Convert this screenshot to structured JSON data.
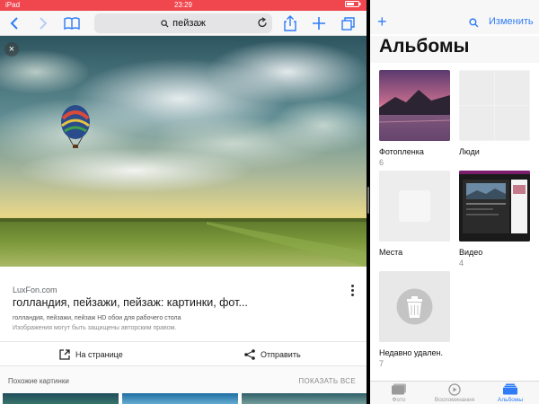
{
  "status_bar": {
    "time": "23:29",
    "left_text": "iPad",
    "battery_text": "■"
  },
  "safari": {
    "search_query": "пейзаж",
    "result": {
      "source": "LuxFon.com",
      "title": "голландия, пейзажи, пейзаж: картинки, фот...",
      "description": "голландия, пейзажи, пейзаж HD обои для рабочего стола",
      "copyright_note": "Изображения могут быть защищены авторским правом."
    },
    "actions": {
      "open_on_page": "На странице",
      "share": "Отправить"
    },
    "similar": {
      "title": "Похожие картинки",
      "show_all": "ПОКАЗАТЬ ВСЕ"
    }
  },
  "photos": {
    "edit_label": "Изменить",
    "title": "Альбомы",
    "albums": [
      {
        "name": "Фотопленка",
        "count": "6"
      },
      {
        "name": "Люди",
        "count": ""
      },
      {
        "name": "Места",
        "count": ""
      },
      {
        "name": "Видео",
        "count": "4"
      },
      {
        "name": "Недавно удален.",
        "count": "7"
      }
    ],
    "tabs": [
      {
        "label": "Фото",
        "active": false
      },
      {
        "label": "Воспоминания",
        "active": false
      },
      {
        "label": "Альбомы",
        "active": true
      }
    ]
  },
  "colors": {
    "accent": "#2f7cf6",
    "status_bar": "#f0474e"
  },
  "icons": [
    "back-icon",
    "forward-icon",
    "bookmarks-icon",
    "search-icon",
    "reload-icon",
    "share-icon",
    "add-tab-icon",
    "tabs-icon",
    "close-icon",
    "open-external-icon",
    "more-vert-icon",
    "plus-icon",
    "trash-icon",
    "photos-icon",
    "memories-icon",
    "albums-icon"
  ]
}
